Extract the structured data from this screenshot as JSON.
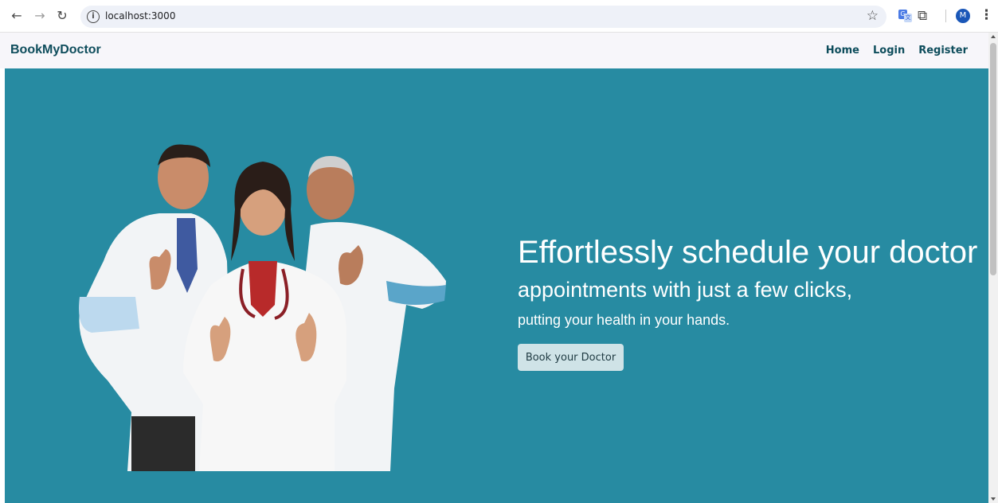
{
  "browser": {
    "url": "localhost:3000",
    "avatar_initial": "M",
    "icons": [
      "back-arrow-icon",
      "forward-arrow-icon",
      "reload-icon",
      "info-icon",
      "bookmark-star-icon",
      "translate-icon",
      "extensions-puzzle-icon",
      "profile-avatar",
      "menu-kebab-icon"
    ]
  },
  "navbar": {
    "brand": "BookMyDoctor",
    "links": [
      "Home",
      "Login",
      "Register"
    ]
  },
  "hero": {
    "headline": "Effortlessly schedule your doctor",
    "subheadline": "appointments with just a few clicks,",
    "tagline": "putting your health in your hands.",
    "cta_label": "Book your Doctor",
    "image": "doctors-thumbs-up-photo"
  },
  "colors": {
    "hero_bg": "#278ba2",
    "navbar_bg": "#f7f6fa",
    "brand_text": "#0e4d5c",
    "cta_bg": "#cfe3e7"
  }
}
